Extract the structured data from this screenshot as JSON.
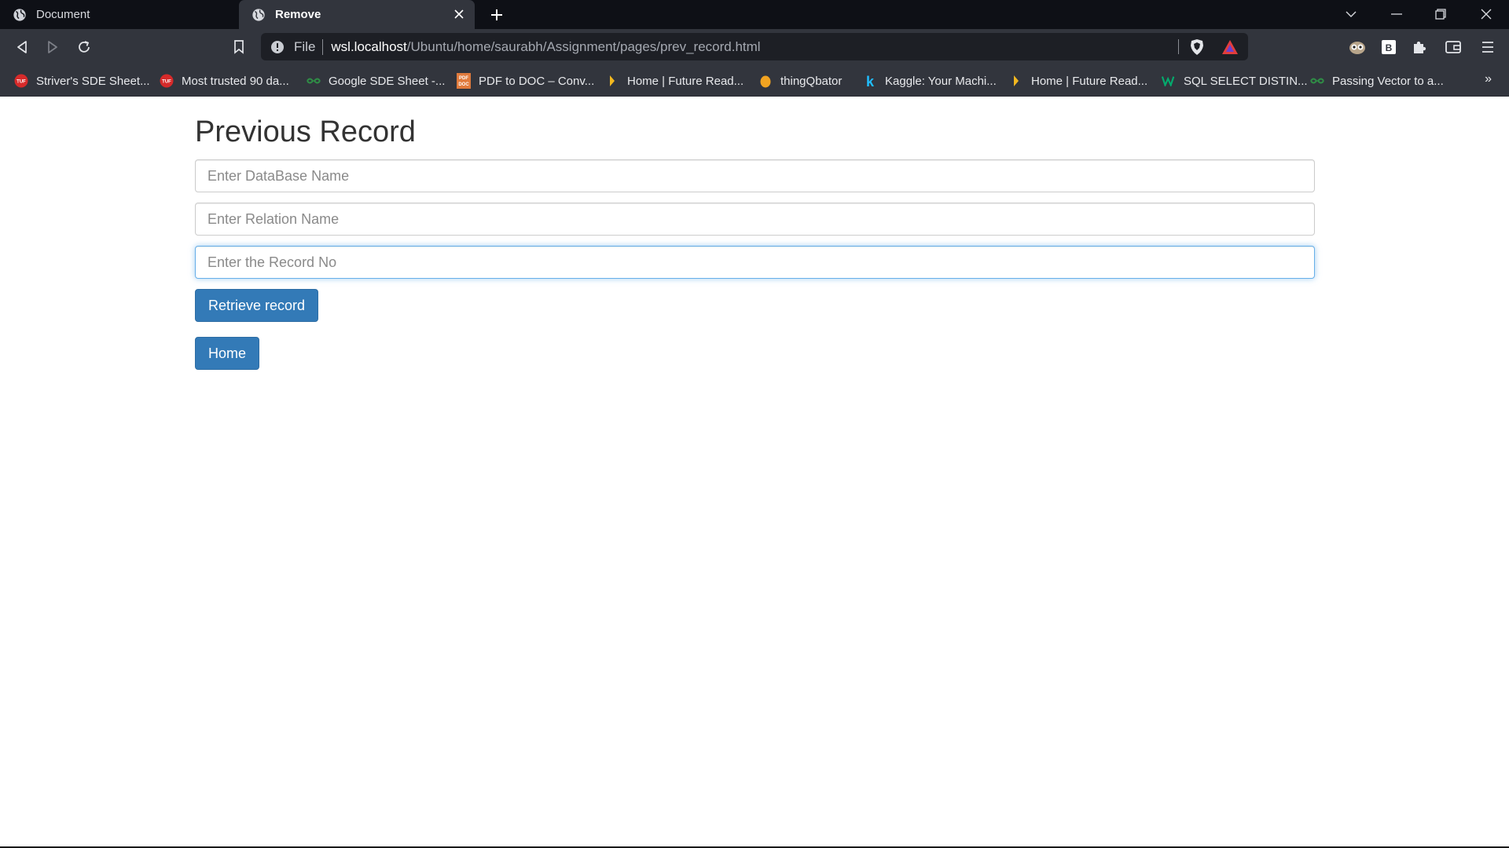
{
  "browser": {
    "tabs": [
      {
        "title": "Document"
      },
      {
        "title": "Remove"
      }
    ],
    "url": {
      "scheme_label": "File",
      "host": "wsl.localhost",
      "path": "/Ubuntu/home/saurabh/Assignment/pages/prev_record.html"
    },
    "bookmarks": [
      {
        "label": "Striver's SDE Sheet...",
        "icon": "tuf-icon"
      },
      {
        "label": "Most trusted 90 da...",
        "icon": "tuf-icon"
      },
      {
        "label": "Google SDE Sheet -...",
        "icon": "gfg-icon"
      },
      {
        "label": "PDF to DOC – Conv...",
        "icon": "pdf-doc-icon"
      },
      {
        "label": "Home | Future Read...",
        "icon": "future-readers-icon"
      },
      {
        "label": "thingQbator",
        "icon": "thingqbator-icon"
      },
      {
        "label": "Kaggle: Your Machi...",
        "icon": "kaggle-icon"
      },
      {
        "label": "Home | Future Read...",
        "icon": "future-readers-icon"
      },
      {
        "label": "SQL SELECT DISTIN...",
        "icon": "w3schools-icon"
      },
      {
        "label": "Passing Vector to a...",
        "icon": "gfg-icon"
      }
    ],
    "bookmarks_more": "»",
    "colors": {
      "tabstrip": "#0e1016",
      "toolbar": "#32353d",
      "urlbar": "#1d1f25"
    }
  },
  "page": {
    "title": "Previous Record",
    "inputs": {
      "database": {
        "placeholder": "Enter DataBase Name",
        "value": ""
      },
      "relation": {
        "placeholder": "Enter Relation Name",
        "value": ""
      },
      "record_no": {
        "placeholder": "Enter the Record No",
        "value": ""
      }
    },
    "buttons": {
      "retrieve": "Retrieve record",
      "home": "Home"
    },
    "colors": {
      "primary": "#337ab7",
      "focus": "#66afe9"
    }
  }
}
